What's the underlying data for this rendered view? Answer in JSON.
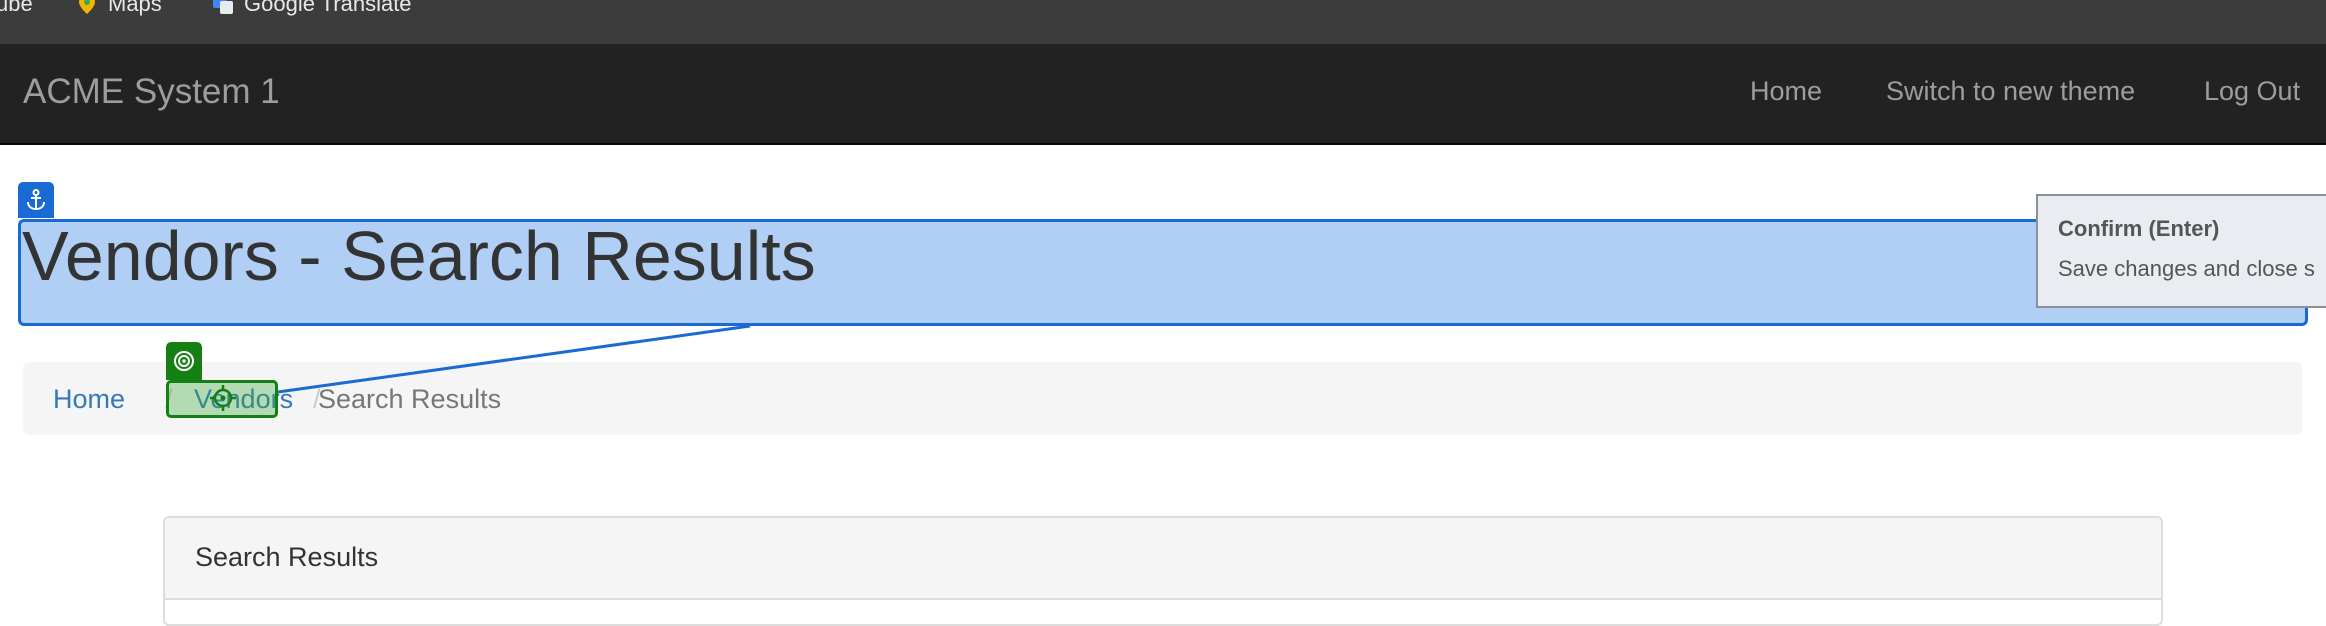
{
  "bookmarks": [
    {
      "label": "ube",
      "icon": "youtube-icon"
    },
    {
      "label": "Maps",
      "icon": "maps-pin-icon"
    },
    {
      "label": "Google Translate",
      "icon": "google-translate-icon"
    }
  ],
  "navbar": {
    "brand": "ACME System 1",
    "links": {
      "home": "Home",
      "theme": "Switch to new theme",
      "logout": "Log Out"
    }
  },
  "page": {
    "title": "Vendors - Search Results"
  },
  "breadcrumb": {
    "home": "Home",
    "separator": "/",
    "vendors": "Vendors",
    "current": "Search Results"
  },
  "panel": {
    "heading": "Search Results"
  },
  "tooltip": {
    "title": "Confirm (Enter)",
    "description": "Save changes and close s"
  },
  "colors": {
    "navbar_bg": "#222222",
    "link": "#337ab7",
    "anchor_blue": "#1a6ad4",
    "target_green": "#148014"
  }
}
